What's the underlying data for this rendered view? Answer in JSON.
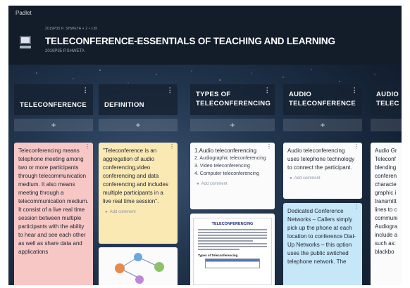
{
  "app": {
    "name": "Padlet"
  },
  "board": {
    "meta": "2019P35 P. SHWETA + 2 • 13h",
    "title": "TELECONFERENCE-ESSENTIALS OF TEACHING AND LEARNING",
    "subtitle": "2019P35 P.SHWETA",
    "logo_icon": "computer-monitor-icon"
  },
  "ui": {
    "add_symbol": "+",
    "kebab_symbol": "⋮",
    "add_comment_label": "Add comment",
    "comment_icon": "user-avatar-icon"
  },
  "columns": [
    {
      "title": "TELECONFERENCE",
      "cards": [
        {
          "text": "Teleconferencing means telephone meeting among two or more participants through telecommunication medium. It also means meeting through a telecommunication medium. It consist of a live real time session between multiple participants with the ability to hear and see each other as well as share data and applications",
          "color": "#f7c7c6"
        }
      ]
    },
    {
      "title": "DEFINITION",
      "cards": [
        {
          "text": "\"Teleconference is an aggregation of audio conferencing,video conferencing and data conferencing and includes multiple participants in a live real time session\".",
          "color": "#fbe9b4"
        }
      ]
    },
    {
      "title_line1": "TYPES OF",
      "title_line2": "TELECONFERENCING",
      "cards": [
        {
          "items": [
            "1.Audio teleconferencing",
            "2. Audiographic teleconferencing",
            "3. Video teleconferencing",
            "4. Computer teleconferencing"
          ],
          "color": "#fbfbfc"
        },
        {
          "doc_title": "TELECONFERENCING",
          "doc_subtitle": "Types of Teleconferencing"
        }
      ]
    },
    {
      "title_line1": "AUDIO",
      "title_line2": "TELECONFERENCE",
      "cards": [
        {
          "text": "Audio teleconferencing uses telephone technology to connect the participant.",
          "color": "#fbfbfc"
        },
        {
          "text": "Dedicated Conference Networks – Callers simply pick up the phone at each location to conference Dial-Up Networks – this option uses the public switched telephone network. The",
          "color": "#c6e7f7"
        }
      ]
    },
    {
      "title_line1": "AUDIO",
      "title_line2": "TELEC",
      "cards": [
        {
          "text": "Audio Gr Teleconf blending conferen characte graphic i transmitt lines to c communi Audiogra include a such as: blackbo",
          "color": "#fbfbfc"
        }
      ]
    }
  ]
}
